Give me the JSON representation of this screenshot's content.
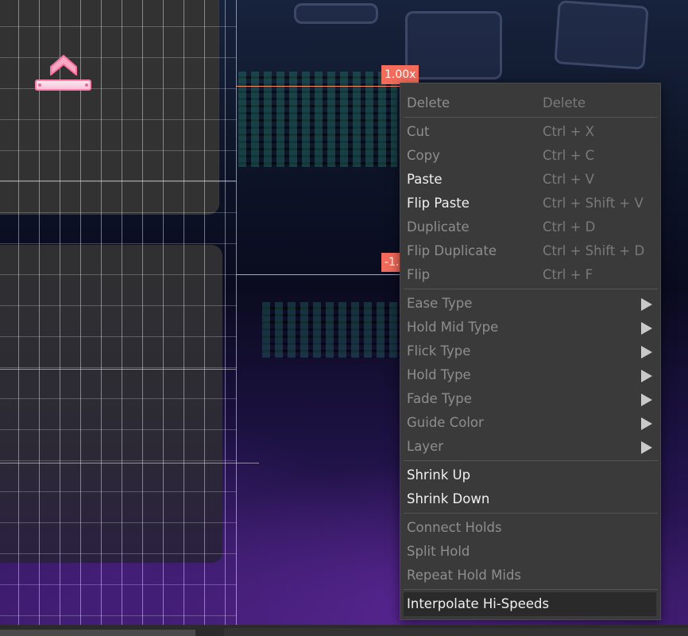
{
  "editor": {
    "speed_markers": [
      {
        "label": "1.00x"
      },
      {
        "label": "-1."
      }
    ]
  },
  "context_menu": {
    "items": [
      {
        "label": "Delete",
        "shortcut": "Delete",
        "enabled": false
      },
      {
        "label": "Cut",
        "shortcut": "Ctrl + X",
        "enabled": false
      },
      {
        "label": "Copy",
        "shortcut": "Ctrl + C",
        "enabled": false
      },
      {
        "label": "Paste",
        "shortcut": "Ctrl + V",
        "enabled": true
      },
      {
        "label": "Flip Paste",
        "shortcut": "Ctrl + Shift + V",
        "enabled": true
      },
      {
        "label": "Duplicate",
        "shortcut": "Ctrl + D",
        "enabled": false
      },
      {
        "label": "Flip Duplicate",
        "shortcut": "Ctrl + Shift + D",
        "enabled": false
      },
      {
        "label": "Flip",
        "shortcut": "Ctrl + F",
        "enabled": false
      },
      {
        "label": "Ease Type",
        "submenu": true,
        "enabled": false
      },
      {
        "label": "Hold Mid Type",
        "submenu": true,
        "enabled": false
      },
      {
        "label": "Flick Type",
        "submenu": true,
        "enabled": false
      },
      {
        "label": "Hold Type",
        "submenu": true,
        "enabled": false
      },
      {
        "label": "Fade Type",
        "submenu": true,
        "enabled": false
      },
      {
        "label": "Guide Color",
        "submenu": true,
        "enabled": false
      },
      {
        "label": "Layer",
        "submenu": true,
        "enabled": false
      },
      {
        "label": "Shrink Up",
        "enabled": true
      },
      {
        "label": "Shrink Down",
        "enabled": true
      },
      {
        "label": "Connect Holds",
        "enabled": false
      },
      {
        "label": "Split Hold",
        "enabled": false
      },
      {
        "label": "Repeat Hold Mids",
        "enabled": false
      },
      {
        "label": "Interpolate Hi-Speeds",
        "enabled": true,
        "highlighted": true
      }
    ]
  },
  "colors": {
    "speed_marker": "#f26b5b",
    "note_border": "#ff7fab",
    "menu_bg": "#3a3a3a"
  }
}
